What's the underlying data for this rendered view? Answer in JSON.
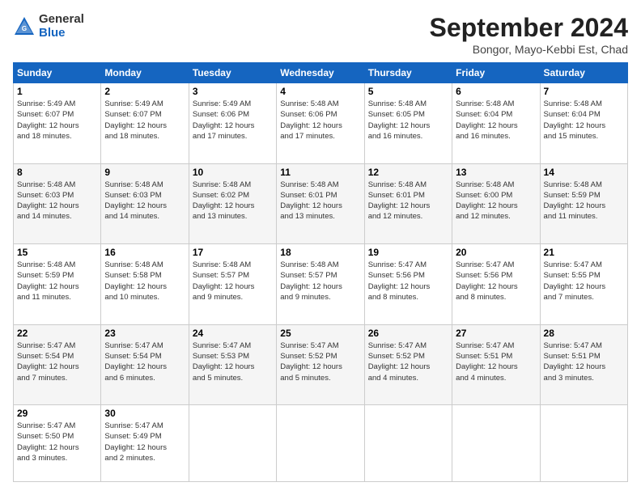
{
  "logo": {
    "general": "General",
    "blue": "Blue"
  },
  "title": "September 2024",
  "location": "Bongor, Mayo-Kebbi Est, Chad",
  "headers": [
    "Sunday",
    "Monday",
    "Tuesday",
    "Wednesday",
    "Thursday",
    "Friday",
    "Saturday"
  ],
  "weeks": [
    [
      {
        "day": "1",
        "info": "Sunrise: 5:49 AM\nSunset: 6:07 PM\nDaylight: 12 hours\nand 18 minutes."
      },
      {
        "day": "2",
        "info": "Sunrise: 5:49 AM\nSunset: 6:07 PM\nDaylight: 12 hours\nand 18 minutes."
      },
      {
        "day": "3",
        "info": "Sunrise: 5:49 AM\nSunset: 6:06 PM\nDaylight: 12 hours\nand 17 minutes."
      },
      {
        "day": "4",
        "info": "Sunrise: 5:48 AM\nSunset: 6:06 PM\nDaylight: 12 hours\nand 17 minutes."
      },
      {
        "day": "5",
        "info": "Sunrise: 5:48 AM\nSunset: 6:05 PM\nDaylight: 12 hours\nand 16 minutes."
      },
      {
        "day": "6",
        "info": "Sunrise: 5:48 AM\nSunset: 6:04 PM\nDaylight: 12 hours\nand 16 minutes."
      },
      {
        "day": "7",
        "info": "Sunrise: 5:48 AM\nSunset: 6:04 PM\nDaylight: 12 hours\nand 15 minutes."
      }
    ],
    [
      {
        "day": "8",
        "info": "Sunrise: 5:48 AM\nSunset: 6:03 PM\nDaylight: 12 hours\nand 14 minutes."
      },
      {
        "day": "9",
        "info": "Sunrise: 5:48 AM\nSunset: 6:03 PM\nDaylight: 12 hours\nand 14 minutes."
      },
      {
        "day": "10",
        "info": "Sunrise: 5:48 AM\nSunset: 6:02 PM\nDaylight: 12 hours\nand 13 minutes."
      },
      {
        "day": "11",
        "info": "Sunrise: 5:48 AM\nSunset: 6:01 PM\nDaylight: 12 hours\nand 13 minutes."
      },
      {
        "day": "12",
        "info": "Sunrise: 5:48 AM\nSunset: 6:01 PM\nDaylight: 12 hours\nand 12 minutes."
      },
      {
        "day": "13",
        "info": "Sunrise: 5:48 AM\nSunset: 6:00 PM\nDaylight: 12 hours\nand 12 minutes."
      },
      {
        "day": "14",
        "info": "Sunrise: 5:48 AM\nSunset: 5:59 PM\nDaylight: 12 hours\nand 11 minutes."
      }
    ],
    [
      {
        "day": "15",
        "info": "Sunrise: 5:48 AM\nSunset: 5:59 PM\nDaylight: 12 hours\nand 11 minutes."
      },
      {
        "day": "16",
        "info": "Sunrise: 5:48 AM\nSunset: 5:58 PM\nDaylight: 12 hours\nand 10 minutes."
      },
      {
        "day": "17",
        "info": "Sunrise: 5:48 AM\nSunset: 5:57 PM\nDaylight: 12 hours\nand 9 minutes."
      },
      {
        "day": "18",
        "info": "Sunrise: 5:48 AM\nSunset: 5:57 PM\nDaylight: 12 hours\nand 9 minutes."
      },
      {
        "day": "19",
        "info": "Sunrise: 5:47 AM\nSunset: 5:56 PM\nDaylight: 12 hours\nand 8 minutes."
      },
      {
        "day": "20",
        "info": "Sunrise: 5:47 AM\nSunset: 5:56 PM\nDaylight: 12 hours\nand 8 minutes."
      },
      {
        "day": "21",
        "info": "Sunrise: 5:47 AM\nSunset: 5:55 PM\nDaylight: 12 hours\nand 7 minutes."
      }
    ],
    [
      {
        "day": "22",
        "info": "Sunrise: 5:47 AM\nSunset: 5:54 PM\nDaylight: 12 hours\nand 7 minutes."
      },
      {
        "day": "23",
        "info": "Sunrise: 5:47 AM\nSunset: 5:54 PM\nDaylight: 12 hours\nand 6 minutes."
      },
      {
        "day": "24",
        "info": "Sunrise: 5:47 AM\nSunset: 5:53 PM\nDaylight: 12 hours\nand 5 minutes."
      },
      {
        "day": "25",
        "info": "Sunrise: 5:47 AM\nSunset: 5:52 PM\nDaylight: 12 hours\nand 5 minutes."
      },
      {
        "day": "26",
        "info": "Sunrise: 5:47 AM\nSunset: 5:52 PM\nDaylight: 12 hours\nand 4 minutes."
      },
      {
        "day": "27",
        "info": "Sunrise: 5:47 AM\nSunset: 5:51 PM\nDaylight: 12 hours\nand 4 minutes."
      },
      {
        "day": "28",
        "info": "Sunrise: 5:47 AM\nSunset: 5:51 PM\nDaylight: 12 hours\nand 3 minutes."
      }
    ],
    [
      {
        "day": "29",
        "info": "Sunrise: 5:47 AM\nSunset: 5:50 PM\nDaylight: 12 hours\nand 3 minutes."
      },
      {
        "day": "30",
        "info": "Sunrise: 5:47 AM\nSunset: 5:49 PM\nDaylight: 12 hours\nand 2 minutes."
      },
      {
        "day": "",
        "info": ""
      },
      {
        "day": "",
        "info": ""
      },
      {
        "day": "",
        "info": ""
      },
      {
        "day": "",
        "info": ""
      },
      {
        "day": "",
        "info": ""
      }
    ]
  ]
}
